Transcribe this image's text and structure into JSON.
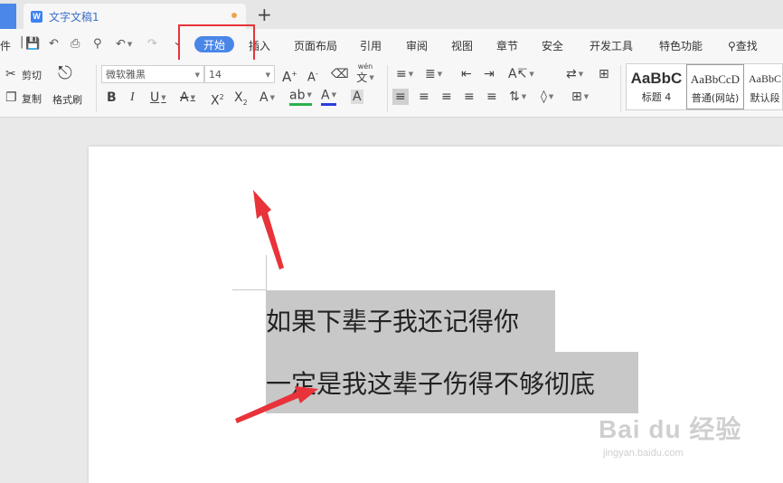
{
  "titlebar": {
    "doc_title": "文字文稿1",
    "doc_icon_letter": "W",
    "new_tab": "+"
  },
  "menubar": {
    "file_partial": "件",
    "tabs": [
      "开始",
      "插入",
      "页面布局",
      "引用",
      "审阅",
      "视图",
      "章节",
      "安全",
      "开发工具",
      "特色功能"
    ],
    "search": "查找"
  },
  "ribbon": {
    "cut": "剪切",
    "copy": "复制",
    "format_painter": "格式刷",
    "font_name": "微软雅黑",
    "font_size": "14",
    "pinyin_glyph": "文",
    "pinyin_ruby": "wén"
  },
  "styles": [
    {
      "sample": "AaBbC",
      "name": "标题 4"
    },
    {
      "sample": "AaBbCcD",
      "name": "普通(网站)"
    },
    {
      "sample": "AaBbC",
      "name": "默认段"
    }
  ],
  "document": {
    "lines": [
      "如果下辈子我还记得你",
      "一定是我这辈子伤得不够彻底"
    ]
  },
  "watermark": {
    "brand": "Bai du 经验",
    "url": "jingyan.baidu.com"
  },
  "colors": {
    "accent": "#4a86e8",
    "highlight_box": "#e8333a",
    "arrow": "#e8333a",
    "selection": "#c8c8c8",
    "unsaved_dot": "#f0a34d"
  }
}
